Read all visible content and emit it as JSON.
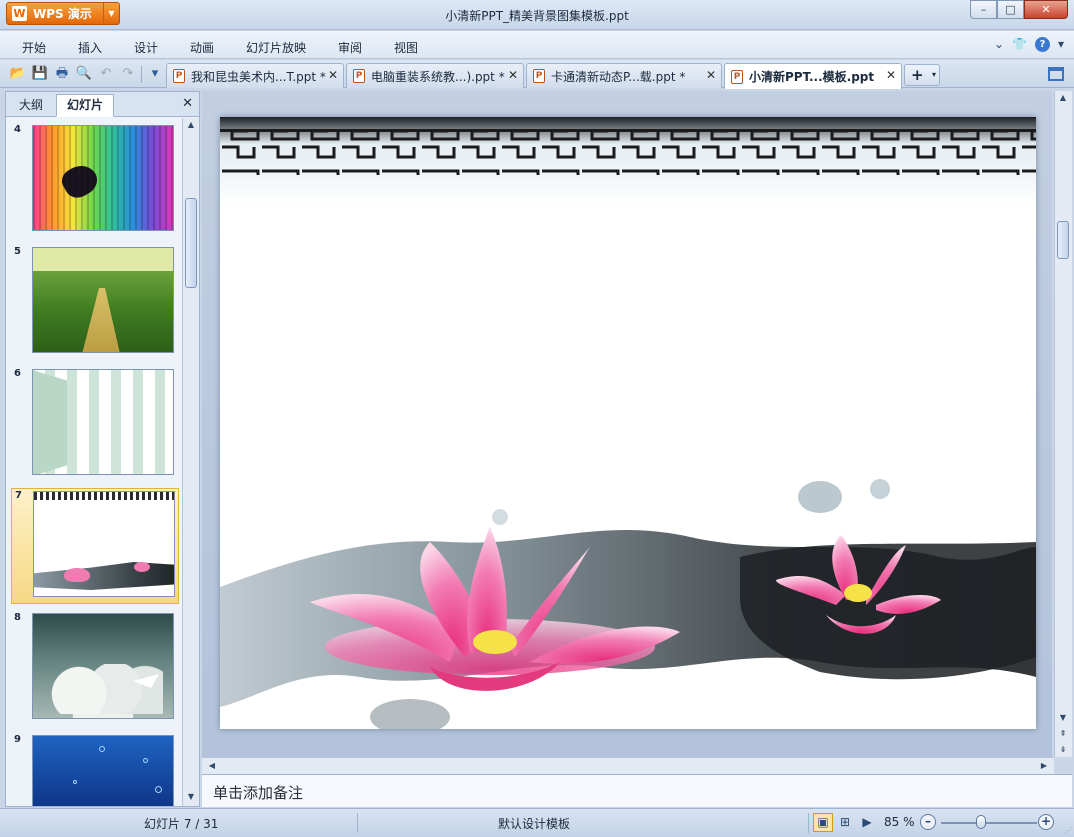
{
  "titlebar": {
    "app_label": "WPS 演示",
    "app_logo": "W",
    "title": "小清新PPT_精美背景图集模板.ppt",
    "controls": {
      "minimize": "–",
      "maximize": "□",
      "close": "✕"
    }
  },
  "menubar": {
    "items": [
      "开始",
      "插入",
      "设计",
      "动画",
      "幻灯片放映",
      "审阅",
      "视图"
    ],
    "right_icons": {
      "collapse": "⌄",
      "skin": "shirt-icon",
      "help": "?"
    }
  },
  "toolbar": {
    "icons": [
      "open-folder-icon",
      "save-icon",
      "print-icon",
      "print-preview-icon",
      "undo-icon",
      "redo-icon",
      "more-dropdown-icon"
    ],
    "glyphs": {
      "open": "📂",
      "save": "💾",
      "print": "🖶",
      "preview": "🔍",
      "undo": "↶",
      "redo": "↷",
      "more": "▾"
    }
  },
  "doc_tabs": [
    {
      "label": "我和昆虫美术内...T.ppt *",
      "active": false
    },
    {
      "label": "电脑重装系统教...).ppt *",
      "active": false
    },
    {
      "label": "卡通清新动态P...载.ppt *",
      "active": false
    },
    {
      "label": "小清新PPT...模板.ppt",
      "active": true
    }
  ],
  "doc_tab_close": "✕",
  "new_tab": {
    "plus": "+",
    "dropdown": "▾"
  },
  "left_pane": {
    "tabs": [
      "大纲",
      "幻灯片"
    ],
    "active_tab": "幻灯片",
    "close": "✕",
    "slides": [
      {
        "number": "4",
        "theme": "rainbow-grunge"
      },
      {
        "number": "5",
        "theme": "green-field-path"
      },
      {
        "number": "6",
        "theme": "mint-stripes"
      },
      {
        "number": "7",
        "theme": "ink-lotus",
        "selected": true
      },
      {
        "number": "8",
        "theme": "clouds-paper-plane"
      },
      {
        "number": "9",
        "theme": "deep-ocean-bubbles"
      }
    ],
    "scroll": {
      "up": "▲",
      "down": "▼",
      "grip": "≡"
    }
  },
  "editor": {
    "slide_theme": "ink-lotus",
    "notes_placeholder": "单击添加备注",
    "scroll": {
      "up": "▲",
      "down": "▼",
      "left": "◀",
      "right": "▶",
      "page_up": "⇞",
      "page_down": "⇟"
    }
  },
  "statusbar": {
    "slide_position": "幻灯片 7 / 31",
    "template": "默认设计模板",
    "views": {
      "normal": "▣",
      "sorter": "⊞",
      "show": "▶"
    },
    "zoom": "85 %",
    "zoom_minus": "–",
    "zoom_plus": "+",
    "zoom_level_percent": 85,
    "grip": "⋰"
  },
  "colors": {
    "app_button": "#e3670b",
    "lotus_pink": "#f07bb0",
    "ink_dark": "#1e2326",
    "selection_highlight": "#f6d884"
  }
}
